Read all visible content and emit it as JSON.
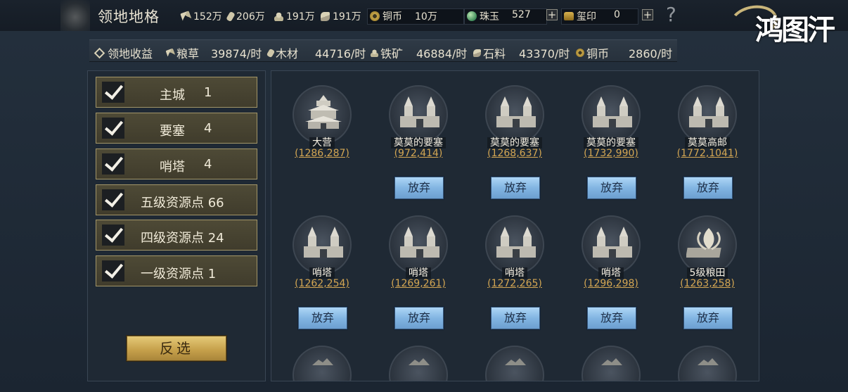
{
  "header": {
    "title": "领地地格",
    "resources": [
      {
        "icon": "grain-icon",
        "value": "152万"
      },
      {
        "icon": "wood-icon",
        "value": "206万"
      },
      {
        "icon": "iron-icon",
        "value": "191万"
      },
      {
        "icon": "stone-icon",
        "value": "191万"
      }
    ],
    "copper": {
      "label": "铜币",
      "value": "10万"
    },
    "jade": {
      "label": "珠玉",
      "value": "527",
      "plus": "+"
    },
    "seal": {
      "label": "玺印",
      "value": "0",
      "plus": "+"
    },
    "help": "?",
    "logo_text": "鸿图汗"
  },
  "income": {
    "title": "领地收益",
    "items": [
      {
        "icon": "grain-icon",
        "label": "粮草",
        "value": "39874/时"
      },
      {
        "icon": "wood-icon",
        "label": "木材",
        "value": "44716/时"
      },
      {
        "icon": "iron-icon",
        "label": "铁矿",
        "value": "46884/时"
      },
      {
        "icon": "stone-icon",
        "label": "石料",
        "value": "43370/时"
      },
      {
        "icon": "coin-icon",
        "label": "铜币",
        "value": "2860/时"
      }
    ]
  },
  "filters": [
    {
      "label": "主城",
      "count": "1",
      "checked": true
    },
    {
      "label": "要塞",
      "count": "4",
      "checked": true
    },
    {
      "label": "哨塔",
      "count": "4",
      "checked": true
    },
    {
      "label": "五级资源点 66",
      "count": "",
      "checked": true
    },
    {
      "label": "四级资源点 24",
      "count": "",
      "checked": true
    },
    {
      "label": "一级资源点 1",
      "count": "",
      "checked": true
    }
  ],
  "invert_label": "反选",
  "tiles": [
    {
      "name": "大营",
      "coord": "(1286,287)",
      "icon": "camp-icon",
      "abandon": ""
    },
    {
      "name": "莫莫的要塞",
      "coord": "(972,414)",
      "icon": "fortress-icon",
      "abandon": "放弃"
    },
    {
      "name": "莫莫的要塞",
      "coord": "(1268,637)",
      "icon": "fortress-icon",
      "abandon": "放弃"
    },
    {
      "name": "莫莫的要塞",
      "coord": "(1732,990)",
      "icon": "fortress-icon",
      "abandon": "放弃"
    },
    {
      "name": "莫莫高邮",
      "coord": "(1772,1041)",
      "icon": "fortress-icon",
      "abandon": "放弃"
    },
    {
      "name": "哨塔",
      "coord": "(1262,254)",
      "icon": "watchtower-icon",
      "abandon": "放弃"
    },
    {
      "name": "哨塔",
      "coord": "(1269,261)",
      "icon": "watchtower-icon",
      "abandon": "放弃"
    },
    {
      "name": "哨塔",
      "coord": "(1272,265)",
      "icon": "watchtower-icon",
      "abandon": "放弃"
    },
    {
      "name": "哨塔",
      "coord": "(1296,298)",
      "icon": "watchtower-icon",
      "abandon": "放弃"
    },
    {
      "name": "5级粮田",
      "coord": "(1263,258)",
      "icon": "grain-field-icon",
      "abandon": "放弃"
    }
  ]
}
